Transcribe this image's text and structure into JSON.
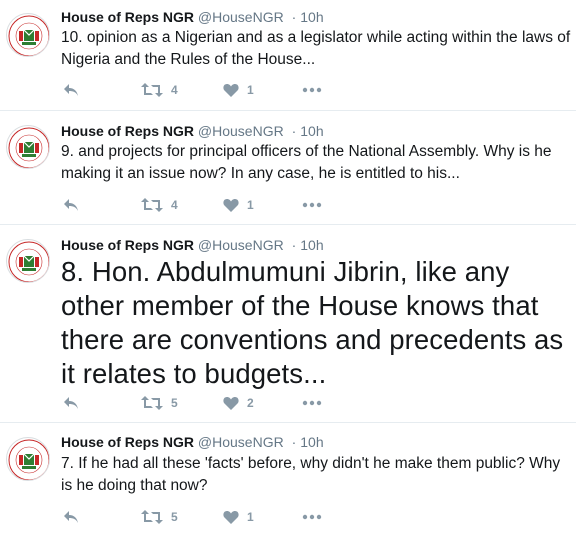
{
  "account": {
    "name": "House of Reps NGR",
    "handle": "@HouseNGR",
    "separator": "·"
  },
  "colors": {
    "icon_gray": "#8899a6",
    "meta_gray": "#657786",
    "divider": "#e6ecf0",
    "seal_green": "#2e7d32",
    "seal_red": "#c62828"
  },
  "tweets": [
    {
      "time": "10h",
      "text": "10. opinion as a Nigerian and as a legislator while acting within the laws of Nigeria and the Rules of the House...",
      "retweets": "4",
      "likes": "1"
    },
    {
      "time": "10h",
      "text": "9. and projects for principal officers of the National Assembly. Why is he making it an issue now? In any case, he is entitled to his...",
      "retweets": "4",
      "likes": "1"
    },
    {
      "time": "10h",
      "text": "8. Hon. Abdulmumuni Jibrin, like any other member of the House knows that there are conventions and precedents as it relates to budgets...",
      "retweets": "5",
      "likes": "2"
    },
    {
      "time": "10h",
      "text": "7. If he had all these 'facts' before, why didn't he make them public? Why is he doing that now?",
      "retweets": "5",
      "likes": "1"
    }
  ],
  "icons": [
    "reply-icon",
    "retweet-icon",
    "heart-icon",
    "more-icon",
    "house-of-reps-seal"
  ]
}
